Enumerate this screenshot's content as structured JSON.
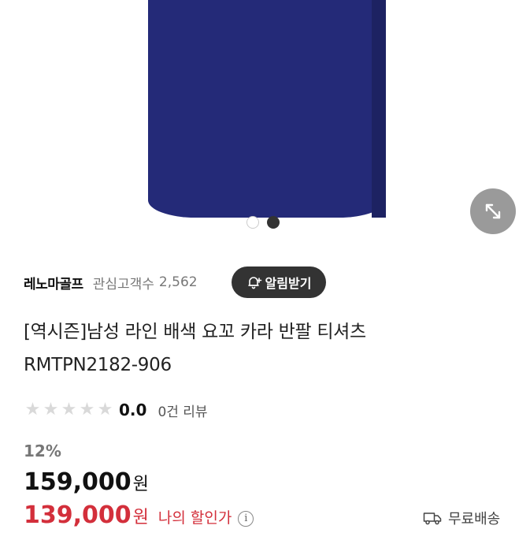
{
  "gallery": {
    "page_count": 2,
    "active_index": 2
  },
  "brand": {
    "name": "레노마골프",
    "followers_label": "관심고객수",
    "followers_count": "2,562",
    "alert_button": "알림받기"
  },
  "product": {
    "title": "[역시즌]남성 라인 배색 요꼬 카라 반팔 티셔츠",
    "code": "RMTPN2182-906"
  },
  "rating": {
    "stars_filled": 0,
    "stars_total": 5,
    "score": "0.0",
    "review_count": "0건 리뷰"
  },
  "price": {
    "discount_rate": "12%",
    "original": "159,000",
    "original_unit": "원",
    "sale": "139,000",
    "sale_unit": "원",
    "sale_label": "나의 할인가"
  },
  "shipping": {
    "label": "무료배송"
  },
  "icons": {
    "expand": "expand-diagonal-icon",
    "bell": "bell-plus-icon",
    "info": "info-icon",
    "truck": "truck-icon"
  },
  "colors": {
    "shirt": "#242a78",
    "sale": "#d32f3b",
    "button_dark": "#333333"
  }
}
